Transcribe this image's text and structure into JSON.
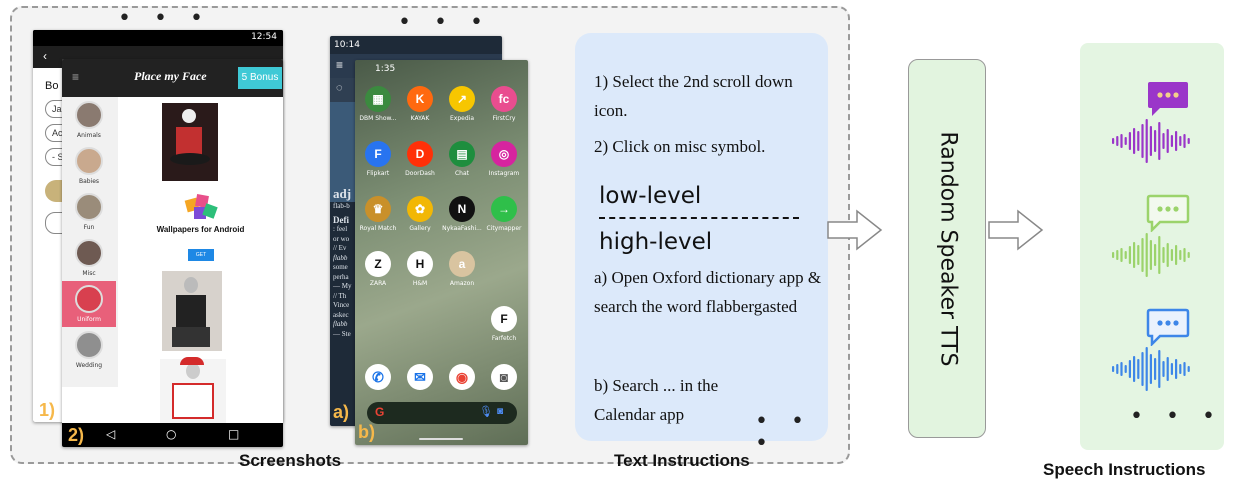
{
  "captions": {
    "screenshots": "Screenshots",
    "text_instructions": "Text Instructions",
    "speech_instructions": "Speech Instructions",
    "tts": "Random Speaker TTS"
  },
  "ellipsis": "• • •",
  "ellipsis_small": ". . .",
  "phone_1": {
    "badge": "1)",
    "status_time": "12:54",
    "back_title": "Bookings",
    "rows": [
      "Bo",
      "Ja",
      "Ac",
      "- S"
    ]
  },
  "phone_2": {
    "badge": "2)",
    "app_title": "Place my Face",
    "bonus_button": "5 Bonus",
    "categories": [
      "Animals",
      "Babies",
      "Fun",
      "Misc",
      "Uniform",
      "Wedding"
    ],
    "promo_title": "Wallpapers for Android",
    "get_button": "GET",
    "nav": [
      "◁",
      "○",
      "□"
    ]
  },
  "phone_a": {
    "badge": "a)",
    "status_time": "10:14",
    "words": [
      "adj",
      "flab-b",
      "Defi",
      ": feel",
      "or wo",
      "// Ev",
      "flabb",
      "some",
      "perha",
      "— My",
      "// Th",
      "Vince",
      "askec",
      "flabb",
      "— Ste"
    ]
  },
  "phone_b": {
    "badge": "b)",
    "status_time": "1:35",
    "apps": [
      {
        "label": "DBM Show...",
        "icon": "android-icon",
        "color": "#3b8a3f",
        "glyph": "▦"
      },
      {
        "label": "KAYAK",
        "icon": "kayak-icon",
        "color": "#ff690f",
        "glyph": "K"
      },
      {
        "label": "Expedia",
        "icon": "expedia-icon",
        "color": "#f7c600",
        "glyph": "↗"
      },
      {
        "label": "FirstCry",
        "icon": "firstcry-icon",
        "color": "#e94d8f",
        "glyph": "fc"
      },
      {
        "label": "Flipkart",
        "icon": "flipkart-icon",
        "color": "#2874f0",
        "glyph": "F"
      },
      {
        "label": "DoorDash",
        "icon": "doordash-icon",
        "color": "#ff3008",
        "glyph": "D"
      },
      {
        "label": "Chat",
        "icon": "chat-icon",
        "color": "#1e8e3e",
        "glyph": "▤"
      },
      {
        "label": "Instagram",
        "icon": "instagram-icon",
        "color": "#d6249f",
        "glyph": "◎"
      },
      {
        "label": "Royal Match",
        "icon": "royal-match-icon",
        "color": "#c9902a",
        "glyph": "♛"
      },
      {
        "label": "Gallery",
        "icon": "gallery-icon",
        "color": "#f2b705",
        "glyph": "✿"
      },
      {
        "label": "NykaaFashi...",
        "icon": "nykaa-icon",
        "color": "#111111",
        "glyph": "N"
      },
      {
        "label": "Citymapper",
        "icon": "citymapper-icon",
        "color": "#2fbf4a",
        "glyph": "→"
      },
      {
        "label": "ZARA",
        "icon": "zara-icon",
        "color": "#ffffff",
        "glyph": "Z"
      },
      {
        "label": "H&M",
        "icon": "hm-icon",
        "color": "#ffffff",
        "glyph": "H"
      },
      {
        "label": "Amazon",
        "icon": "amazon-icon",
        "color": "#d9c4a0",
        "glyph": "a"
      },
      {
        "label": "",
        "icon": "blank",
        "color": "transparent",
        "glyph": ""
      },
      {
        "label": "",
        "icon": "blank",
        "color": "transparent",
        "glyph": ""
      },
      {
        "label": "",
        "icon": "blank",
        "color": "transparent",
        "glyph": ""
      },
      {
        "label": "",
        "icon": "blank",
        "color": "transparent",
        "glyph": ""
      },
      {
        "label": "Farfetch",
        "icon": "farfetch-icon",
        "color": "#ffffff",
        "glyph": "F"
      }
    ],
    "dock": [
      {
        "icon": "phone-icon",
        "color": "#1a73e8",
        "glyph": "✆"
      },
      {
        "icon": "messages-icon",
        "color": "#1a73e8",
        "glyph": "✉"
      },
      {
        "icon": "chrome-icon",
        "color": "#ea4335",
        "glyph": "◉"
      },
      {
        "icon": "camera-icon",
        "color": "#555555",
        "glyph": "◙"
      }
    ],
    "search_letter": "G"
  },
  "text_panel": {
    "low_1": "1) Select the 2nd scroll down icon.",
    "low_2": "2) Click on misc symbol.",
    "low_label": "low-level",
    "high_label": "high-level",
    "high_a": "a) Open Oxford dictionary app & search the word flabbergasted",
    "high_b": "b) Search ... in the Calendar app"
  },
  "colors": {
    "text_panel_bg": "#dce9fa",
    "tts_bg": "#e2f4df",
    "speech_bg": "#e4f5e2",
    "purple": "#9a36c9",
    "green": "#9bd36b",
    "blue": "#3d86e8"
  }
}
